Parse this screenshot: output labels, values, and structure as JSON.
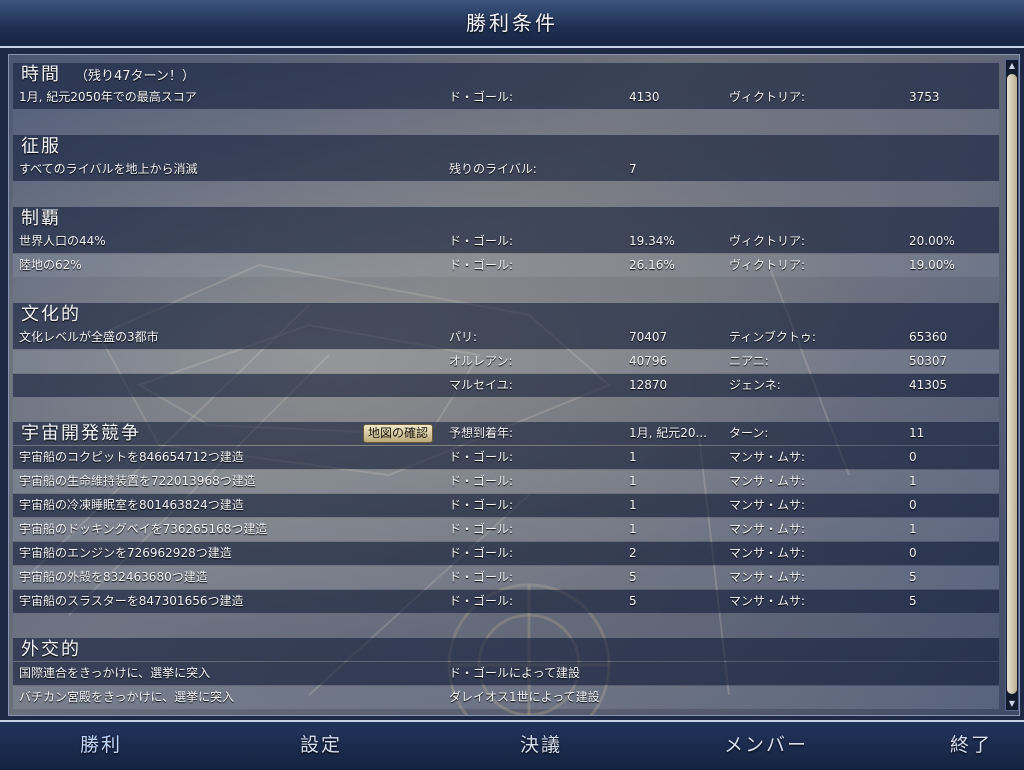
{
  "title": "勝利条件",
  "sections": {
    "time": {
      "heading": "時間",
      "subtitle": "（残り47ターン！）",
      "rows": [
        [
          "1月, 紀元2050年での最高スコア",
          "ド・ゴール:",
          "4130",
          "ヴィクトリア:",
          "3753"
        ]
      ]
    },
    "conquest": {
      "heading": "征服",
      "rows": [
        [
          "すべてのライバルを地上から消滅",
          "残りのライバル:",
          "7",
          "",
          ""
        ]
      ]
    },
    "domination": {
      "heading": "制覇",
      "rows": [
        [
          "世界人口の44%",
          "ド・ゴール:",
          "19.34%",
          "ヴィクトリア:",
          "20.00%"
        ],
        [
          "陸地の62%",
          "ド・ゴール:",
          "26.16%",
          "ヴィクトリア:",
          "19.00%"
        ]
      ]
    },
    "culture": {
      "heading": "文化的",
      "rows": [
        [
          "文化レベルが全盛の3都市",
          "パリ:",
          "70407",
          "ティンブクトゥ:",
          "65360"
        ],
        [
          "",
          "オルレアン:",
          "40796",
          "ニアニ:",
          "50307"
        ],
        [
          "",
          "マルセイユ:",
          "12870",
          "ジェンネ:",
          "41305"
        ]
      ]
    },
    "space": {
      "heading": "宇宙開発競争",
      "map_button": "地図の確認",
      "rows": [
        [
          "",
          "予想到着年:",
          "1月, 紀元20...",
          "ターン:",
          "11"
        ],
        [
          "宇宙船のコクピットを846654712つ建造",
          "ド・ゴール:",
          "1",
          "マンサ・ムサ:",
          "0"
        ],
        [
          "宇宙船の生命維持装置を722013968つ建造",
          "ド・ゴール:",
          "1",
          "マンサ・ムサ:",
          "1"
        ],
        [
          "宇宙船の冷凍睡眠室を801463824つ建造",
          "ド・ゴール:",
          "1",
          "マンサ・ムサ:",
          "0"
        ],
        [
          "宇宙船のドッキングベイを736265168つ建造",
          "ド・ゴール:",
          "1",
          "マンサ・ムサ:",
          "1"
        ],
        [
          "宇宙船のエンジンを726962928つ建造",
          "ド・ゴール:",
          "2",
          "マンサ・ムサ:",
          "0"
        ],
        [
          "宇宙船の外殻を832463680つ建造",
          "ド・ゴール:",
          "5",
          "マンサ・ムサ:",
          "5"
        ],
        [
          "宇宙船のスラスターを847301656つ建造",
          "ド・ゴール:",
          "5",
          "マンサ・ムサ:",
          "5"
        ]
      ]
    },
    "diplomatic": {
      "heading": "外交的",
      "rows": [
        [
          "国際連合をきっかけに、選挙に突入",
          "ド・ゴールによって建設",
          "",
          "",
          ""
        ],
        [
          "バチカン宮殿をきっかけに、選挙に突入",
          "ダレイオス1世によって建設",
          "",
          "",
          ""
        ]
      ]
    }
  },
  "tabs": [
    "勝利",
    "設定",
    "決議",
    "メンバー",
    "終了"
  ],
  "active_tab": "勝利",
  "scroll_up_glyph": "▲",
  "scroll_down_glyph": "▼"
}
